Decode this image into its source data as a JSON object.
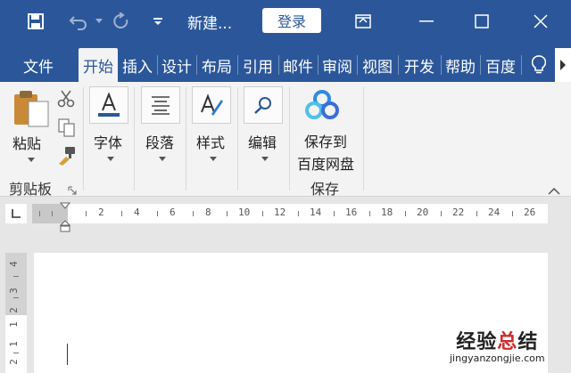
{
  "titlebar": {
    "doc_title": "新建...",
    "login_label": "登录",
    "bg_color": "#2b579a"
  },
  "tabs": [
    {
      "label": "文件"
    },
    {
      "label": "开始",
      "active": true
    },
    {
      "label": "插入"
    },
    {
      "label": "设计"
    },
    {
      "label": "布局"
    },
    {
      "label": "引用"
    },
    {
      "label": "邮件"
    },
    {
      "label": "审阅"
    },
    {
      "label": "视图"
    },
    {
      "label": "开发"
    },
    {
      "label": "帮助"
    },
    {
      "label": "百度"
    }
  ],
  "ribbon": {
    "paste_label": "粘贴",
    "clipboard_group": "剪贴板",
    "font_label": "字体",
    "paragraph_label": "段落",
    "styles_label": "样式",
    "editing_label": "编辑",
    "save_to_baidu_line1": "保存到",
    "save_to_baidu_line2": "百度网盘",
    "save_group": "保存"
  },
  "ruler": {
    "labels": [
      "2",
      "4",
      "6",
      "8",
      "10",
      "12",
      "14",
      "16",
      "18",
      "20",
      "22",
      "24",
      "26"
    ]
  },
  "vruler": {
    "labels": [
      "4",
      "3",
      "2",
      "1",
      "1",
      "2"
    ]
  },
  "watermark": {
    "main_black": "经验",
    "main_red": "总",
    "main_black2": "结",
    "url": "jingyanzongjie.com"
  }
}
